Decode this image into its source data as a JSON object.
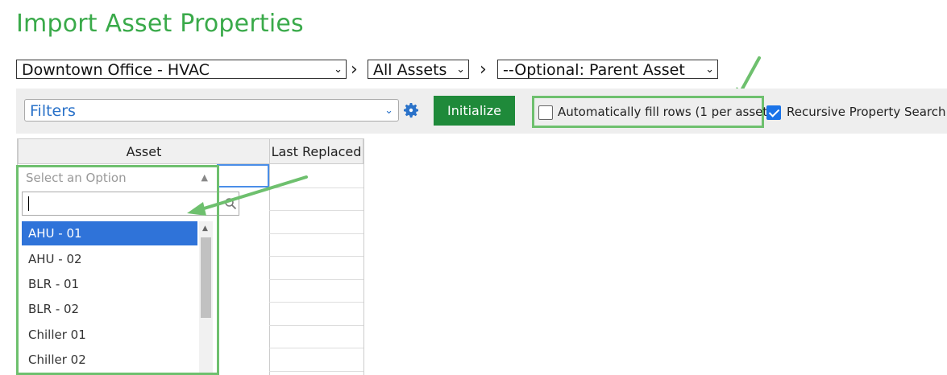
{
  "page": {
    "title": "Import Asset Properties"
  },
  "location_select": {
    "value": "Downtown Office - HVAC"
  },
  "asset_type_select": {
    "value": "All Assets"
  },
  "parent_select": {
    "value": "--Optional: Parent Asset"
  },
  "crumb_sep": "›",
  "toolbar": {
    "filters_value": "Filters",
    "initialize_label": "Initialize",
    "autofill_label": "Automatically fill rows (1 per asset)",
    "autofill_checked": false,
    "recursive_label": "Recursive Property Search",
    "recursive_checked": true
  },
  "grid": {
    "columns": [
      "Asset",
      "Last Replaced"
    ]
  },
  "asset_dropdown": {
    "placeholder": "Select an Option",
    "search_value": "",
    "options": [
      "AHU - 01",
      "AHU - 02",
      "BLR - 01",
      "BLR - 02",
      "Chiller 01",
      "Chiller 02"
    ],
    "selected_index": 0
  },
  "colors": {
    "title": "#3aaa4a",
    "initialize": "#1f8a3a",
    "highlight": "#6ec06e",
    "selected_option": "#2f73d9",
    "filters_text": "#2a72c9"
  }
}
